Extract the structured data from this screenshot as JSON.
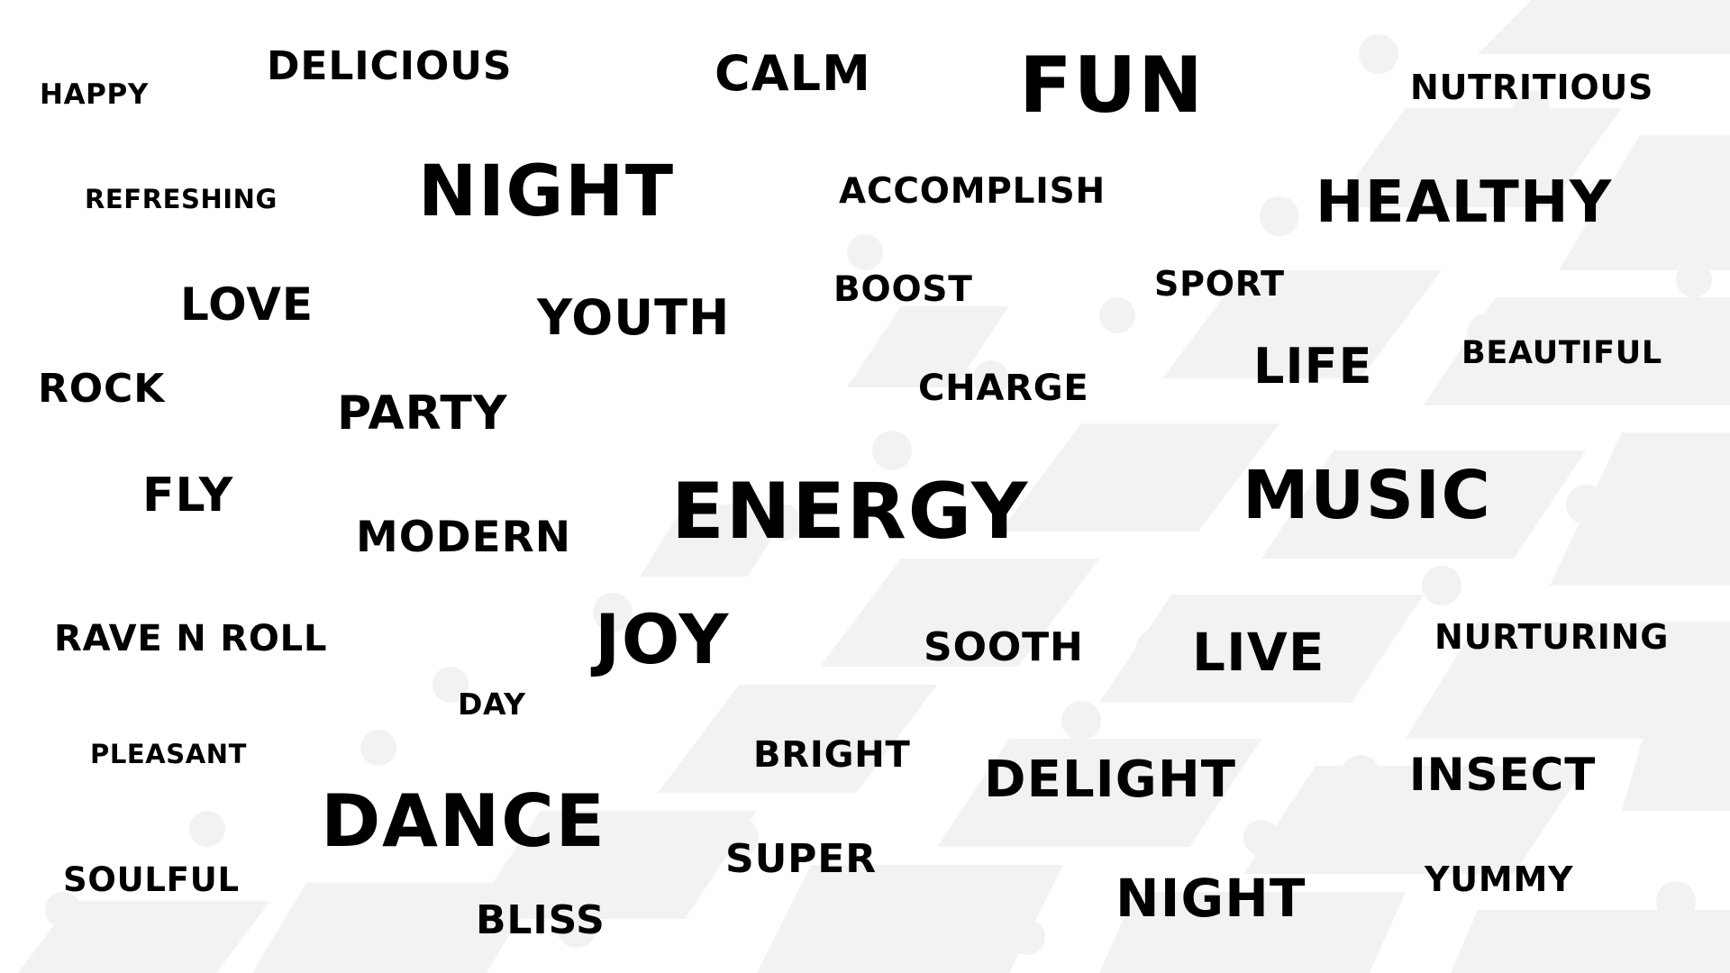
{
  "colors": {
    "background": "#ffffff",
    "pattern": "#f2f2f3",
    "text": "#000000"
  },
  "words": {
    "happy": "HAPPY",
    "delicious": "DELICIOUS",
    "calm": "CALM",
    "fun": "FUN",
    "nutritious": "NUTRITIOUS",
    "refreshing": "REFRESHING",
    "night_top": "NIGHT",
    "accomplish": "ACCOMPLISH",
    "healthy": "HEALTHY",
    "love": "LOVE",
    "youth": "YOUTH",
    "boost": "BOOST",
    "sport": "SPORT",
    "rock": "ROCK",
    "party": "PARTY",
    "charge": "CHARGE",
    "life": "LIFE",
    "beautiful": "BEAUTIFUL",
    "fly": "FLY",
    "modern": "MODERN",
    "energy": "ENERGY",
    "music": "MUSIC",
    "rave_n_roll": "RAVE N ROLL",
    "joy": "JOY",
    "sooth": "SOOTH",
    "live": "LIVE",
    "nurturing": "NURTURING",
    "day": "DAY",
    "pleasant": "PLEASANT",
    "bright": "BRIGHT",
    "delight": "DELIGHT",
    "insect": "INSECT",
    "dance": "DANCE",
    "super": "SUPER",
    "soulful": "SOULFUL",
    "bliss": "BLISS",
    "night_bottom": "NIGHT",
    "yummy": "YUMMY"
  }
}
